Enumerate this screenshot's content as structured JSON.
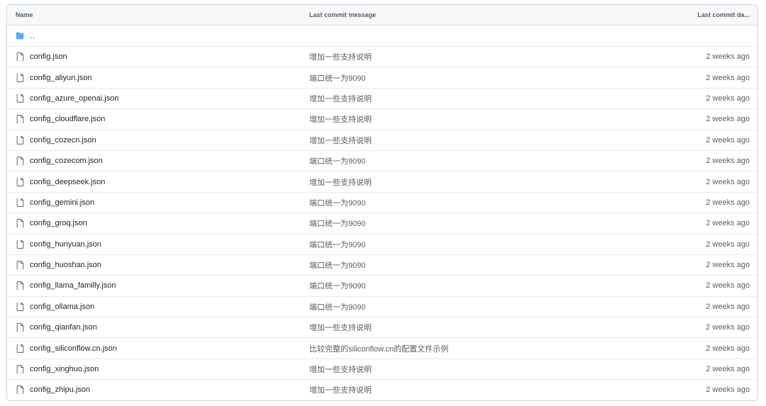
{
  "header": {
    "name": "Name",
    "message": "Last commit message",
    "date": "Last commit da..."
  },
  "parent": {
    "label": ".."
  },
  "icons": {
    "folder": "folder-icon",
    "file": "file-icon"
  },
  "colors": {
    "folder": "#54aeff",
    "file": "#57606a",
    "border": "#d0d7de",
    "header_bg": "#f6f8fa"
  },
  "files": [
    {
      "name": "config.json",
      "message": "增加一些支持说明",
      "date": "2 weeks ago"
    },
    {
      "name": "config_aliyun.json",
      "message": "端口统一为9090",
      "date": "2 weeks ago"
    },
    {
      "name": "config_azure_openai.json",
      "message": "增加一些支持说明",
      "date": "2 weeks ago"
    },
    {
      "name": "config_cloudflare.json",
      "message": "增加一些支持说明",
      "date": "2 weeks ago"
    },
    {
      "name": "config_cozecn.json",
      "message": "增加一些支持说明",
      "date": "2 weeks ago"
    },
    {
      "name": "config_cozecom.json",
      "message": "端口统一为9090",
      "date": "2 weeks ago"
    },
    {
      "name": "config_deepseek.json",
      "message": "增加一些支持说明",
      "date": "2 weeks ago"
    },
    {
      "name": "config_gemini.json",
      "message": "端口统一为9090",
      "date": "2 weeks ago"
    },
    {
      "name": "config_groq.json",
      "message": "端口统一为9090",
      "date": "2 weeks ago"
    },
    {
      "name": "config_hunyuan.json",
      "message": "端口统一为9090",
      "date": "2 weeks ago"
    },
    {
      "name": "config_huoshan.json",
      "message": "端口统一为9090",
      "date": "2 weeks ago"
    },
    {
      "name": "config_llama_familly.json",
      "message": "端口统一为9090",
      "date": "2 weeks ago"
    },
    {
      "name": "config_ollama.json",
      "message": "端口统一为9090",
      "date": "2 weeks ago"
    },
    {
      "name": "config_qianfan.json",
      "message": "增加一些支持说明",
      "date": "2 weeks ago"
    },
    {
      "name": "config_siliconflow.cn.json",
      "message": "比较完整的siliconflow.cn的配置文件示例",
      "date": "2 weeks ago"
    },
    {
      "name": "config_xinghuo.json",
      "message": "增加一些支持说明",
      "date": "2 weeks ago"
    },
    {
      "name": "config_zhipu.json",
      "message": "增加一些支持说明",
      "date": "2 weeks ago"
    }
  ]
}
